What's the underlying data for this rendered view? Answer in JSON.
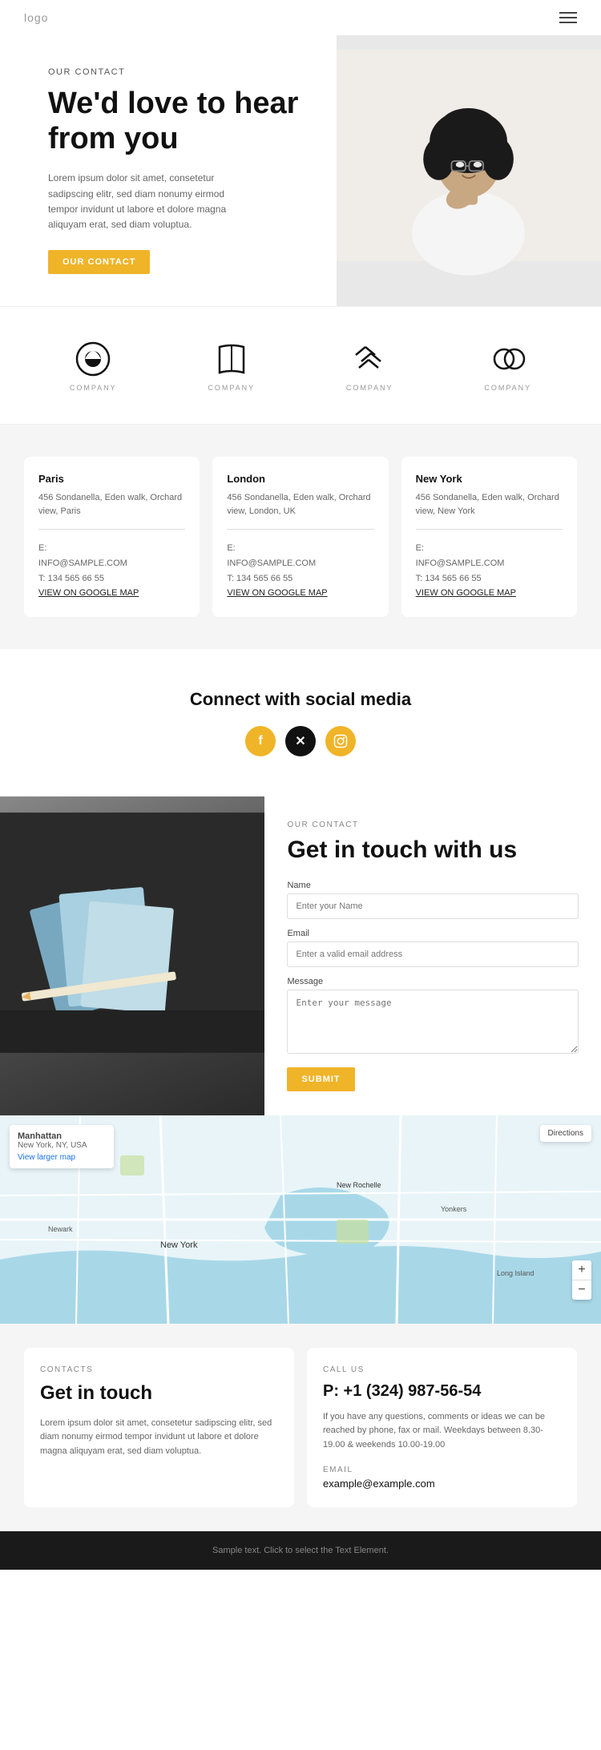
{
  "header": {
    "logo": "logo",
    "menu_icon": "≡"
  },
  "hero": {
    "label": "OUR CONTACT",
    "title": "We'd love to hear from you",
    "description": "Lorem ipsum dolor sit amet, consetetur sadipscing elitr, sed diam nonumy eirmod tempor invidunt ut labore et dolore magna aliquyam erat, sed diam voluptua.",
    "cta_button": "OUR CONTACT"
  },
  "partners": [
    {
      "id": "p1",
      "label": "COMPANY"
    },
    {
      "id": "p2",
      "label": "COMPANY"
    },
    {
      "id": "p3",
      "label": "COMPANY"
    },
    {
      "id": "p4",
      "label": "COMPANY"
    }
  ],
  "offices": [
    {
      "city": "Paris",
      "address": "456 Sondanella, Eden walk, Orchard view, Paris",
      "email_label": "E:",
      "email": "INFO@SAMPLE.COM",
      "phone_label": "T:",
      "phone": "134 565 66 55",
      "map_link": "VIEW ON GOOGLE MAP"
    },
    {
      "city": "London",
      "address": "456 Sondanella, Eden walk, Orchard view, London, UK",
      "email_label": "E:",
      "email": "INFO@SAMPLE.COM",
      "phone_label": "T:",
      "phone": "134 565 66 55",
      "map_link": "VIEW ON GOOGLE MAP"
    },
    {
      "city": "New York",
      "address": "456 Sondanella, Eden walk, Orchard view, New York",
      "email_label": "E:",
      "email": "INFO@SAMPLE.COM",
      "phone_label": "T:",
      "phone": "134 565 66 55",
      "map_link": "VIEW ON GOOGLE MAP"
    }
  ],
  "social": {
    "title": "Connect with social media",
    "icons": [
      "f",
      "𝕏",
      "📷"
    ]
  },
  "contact_form": {
    "label": "OUR CONTACT",
    "title": "Get in touch with us",
    "fields": {
      "name_label": "Name",
      "name_placeholder": "Enter your Name",
      "email_label": "Email",
      "email_placeholder": "Enter a valid email address",
      "message_label": "Message",
      "message_placeholder": "Enter your message"
    },
    "submit_button": "SUBMIT"
  },
  "map": {
    "city": "Manhattan",
    "state": "New York, NY, USA",
    "view_link": "View larger map",
    "directions": "Directions",
    "zoom_in": "+",
    "zoom_out": "−"
  },
  "bottom_contacts": {
    "left": {
      "label": "CONTACTS",
      "title": "Get in touch",
      "text": "Lorem ipsum dolor sit amet, consetetur sadipscing elitr, sed diam nonumy eirmod tempor invidunt ut labore et dolore magna aliquyam erat, sed diam voluptua."
    },
    "right": {
      "label": "CALL US",
      "phone": "P: +1 (324) 987-56-54",
      "description": "If you have any questions, comments or ideas we can be reached by phone, fax or mail. Weekdays between 8.30-19.00 & weekends 10.00-19.00",
      "email_label": "EMAIL",
      "email": "example@example.com"
    }
  },
  "footer": {
    "text": "Sample text. Click to select the Text Element."
  }
}
